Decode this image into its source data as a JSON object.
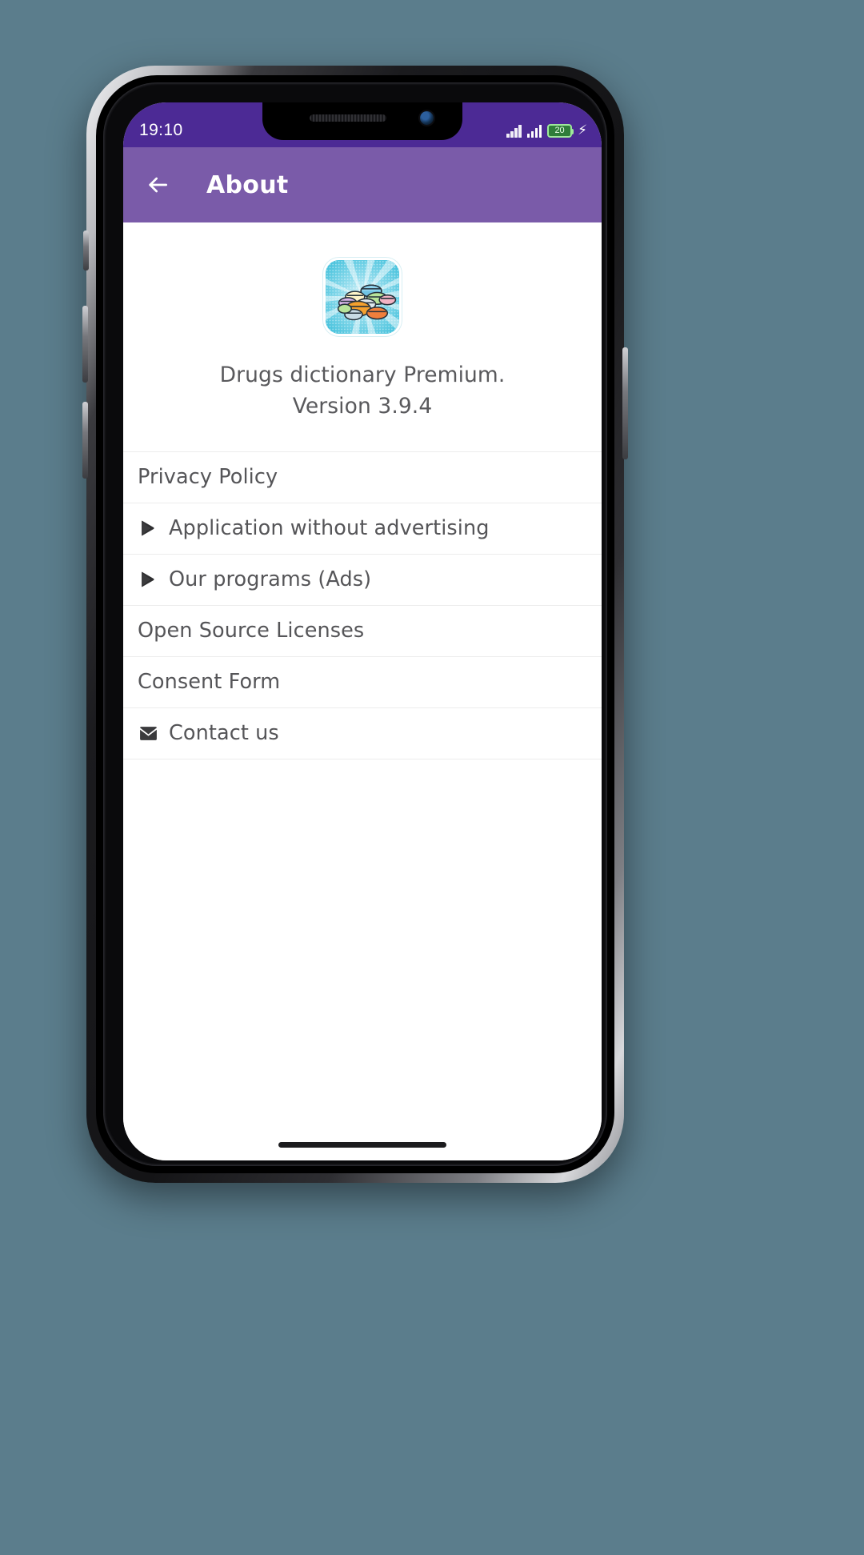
{
  "status_bar": {
    "time": "19:10",
    "battery_level": "20",
    "charging_icon": "charging-bolt-icon",
    "signal_icon": "signal-bars-icon"
  },
  "app_bar": {
    "back_icon": "back-arrow-icon",
    "title": "About"
  },
  "hero": {
    "app_icon_name": "app-icon-pills",
    "version_text": "Drugs dictionary Premium. Version 3.9.4"
  },
  "list": {
    "items": [
      {
        "label": "Privacy Policy",
        "icon": null
      },
      {
        "label": "Application without advertising",
        "icon": "play-store-icon"
      },
      {
        "label": "Our programs (Ads)",
        "icon": "play-store-icon"
      },
      {
        "label": "Open Source Licenses",
        "icon": null
      },
      {
        "label": "Consent Form",
        "icon": null
      },
      {
        "label": "Contact us",
        "icon": "mail-icon"
      }
    ]
  },
  "colors": {
    "status_bar": "#4c2a95",
    "app_bar": "#7a5ba9",
    "text": "#555558",
    "background": "#5b7d8c"
  }
}
